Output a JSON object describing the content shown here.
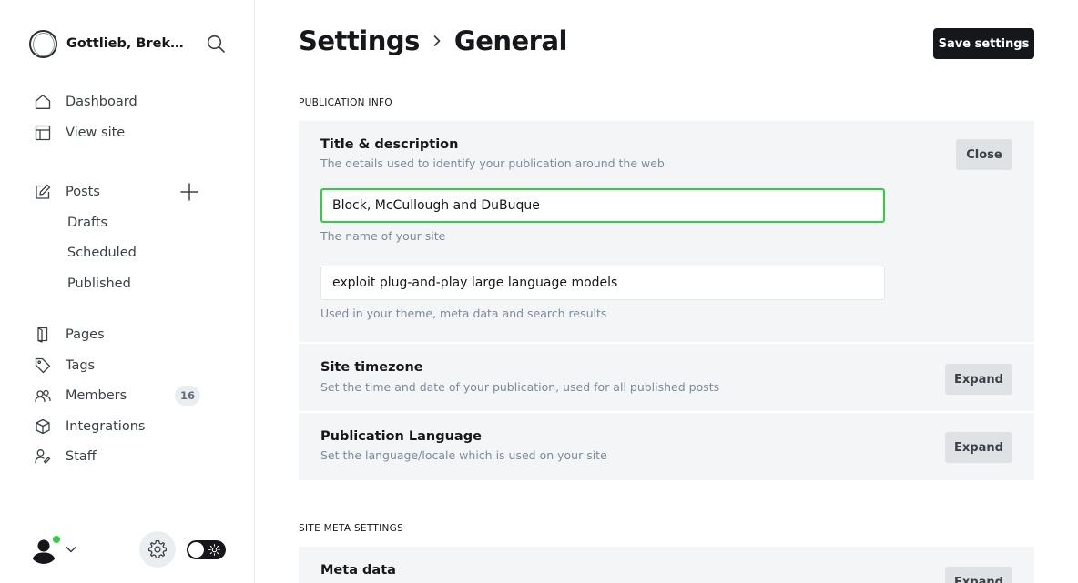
{
  "brand": {
    "name": "Gottlieb, Brekke..."
  },
  "nav": {
    "dashboard": "Dashboard",
    "view_site": "View site",
    "posts": "Posts",
    "drafts": "Drafts",
    "scheduled": "Scheduled",
    "published": "Published",
    "pages": "Pages",
    "tags": "Tags",
    "members": "Members",
    "members_count": "16",
    "integrations": "Integrations",
    "staff": "Staff"
  },
  "header": {
    "crumb_parent": "Settings",
    "crumb_current": "General",
    "save_label": "Save settings"
  },
  "sections": {
    "publication_info": "PUBLICATION INFO",
    "site_meta": "SITE META SETTINGS"
  },
  "title_desc": {
    "title": "Title & description",
    "desc": "The details used to identify your publication around the web",
    "button": "Close",
    "site_title_value": "Block, McCullough and DuBuque",
    "site_title_hint": "The name of your site",
    "site_desc_value": "exploit plug-and-play large language models",
    "site_desc_hint": "Used in your theme, meta data and search results"
  },
  "timezone": {
    "title": "Site timezone",
    "desc": "Set the time and date of your publication, used for all published posts",
    "button": "Expand"
  },
  "language": {
    "title": "Publication Language",
    "desc": "Set the language/locale which is used on your site",
    "button": "Expand"
  },
  "meta": {
    "title": "Meta data",
    "button": "Expand"
  },
  "colors": {
    "accent_green": "#30cf43",
    "dark": "#15171a"
  }
}
